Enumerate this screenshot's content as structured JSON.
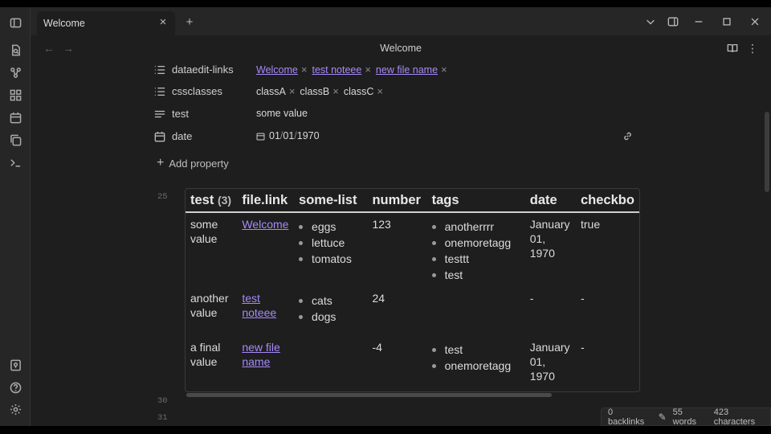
{
  "tabs": [
    {
      "label": "Welcome"
    }
  ],
  "view": {
    "title": "Welcome"
  },
  "properties": [
    {
      "key": "dataedit-links",
      "icon": "list-icon",
      "items": [
        {
          "text": "Welcome",
          "link": true
        },
        {
          "text": "test noteee",
          "link": true
        },
        {
          "text": "new file name",
          "link": true
        }
      ]
    },
    {
      "key": "cssclasses",
      "icon": "list-icon",
      "items": [
        {
          "text": "classA",
          "link": false
        },
        {
          "text": "classB",
          "link": false
        },
        {
          "text": "classC",
          "link": false
        }
      ]
    },
    {
      "key": "test",
      "icon": "text-icon",
      "value": "some value"
    },
    {
      "key": "date",
      "icon": "calendar-icon",
      "date": {
        "m": "01",
        "d": "01",
        "y": "1970"
      }
    }
  ],
  "add_property_label": "Add property",
  "line_numbers": {
    "table_start": "25",
    "after_a": "30",
    "after_b": "31"
  },
  "table": {
    "headers": [
      "test",
      "file.link",
      "some-list",
      "number",
      "tags",
      "date",
      "checkbo"
    ],
    "first_header_count": "(3)",
    "rows": [
      {
        "test": "some value",
        "link": "Welcome",
        "list": [
          "eggs",
          "lettuce",
          "tomatos"
        ],
        "number": "123",
        "tags": [
          "anotherrrr",
          "onemoretagg",
          "testtt",
          "test"
        ],
        "date": "January 01, 1970",
        "checkbox": "true"
      },
      {
        "test": "another value",
        "link": "test noteee",
        "list": [
          "cats",
          "dogs"
        ],
        "number": "24",
        "tags": [],
        "date": "-",
        "checkbox": "-"
      },
      {
        "test": "a final value",
        "link": "new file name",
        "list": [],
        "number": "-4",
        "tags": [
          "test",
          "onemoretagg"
        ],
        "date": "January 01, 1970",
        "checkbox": "-"
      }
    ]
  },
  "status": {
    "backlinks": "0 backlinks",
    "words": "55 words",
    "characters": "423 characters"
  },
  "colors": {
    "link": "#a68af9",
    "background": "#1e1e1e",
    "sidebar": "#262626"
  }
}
